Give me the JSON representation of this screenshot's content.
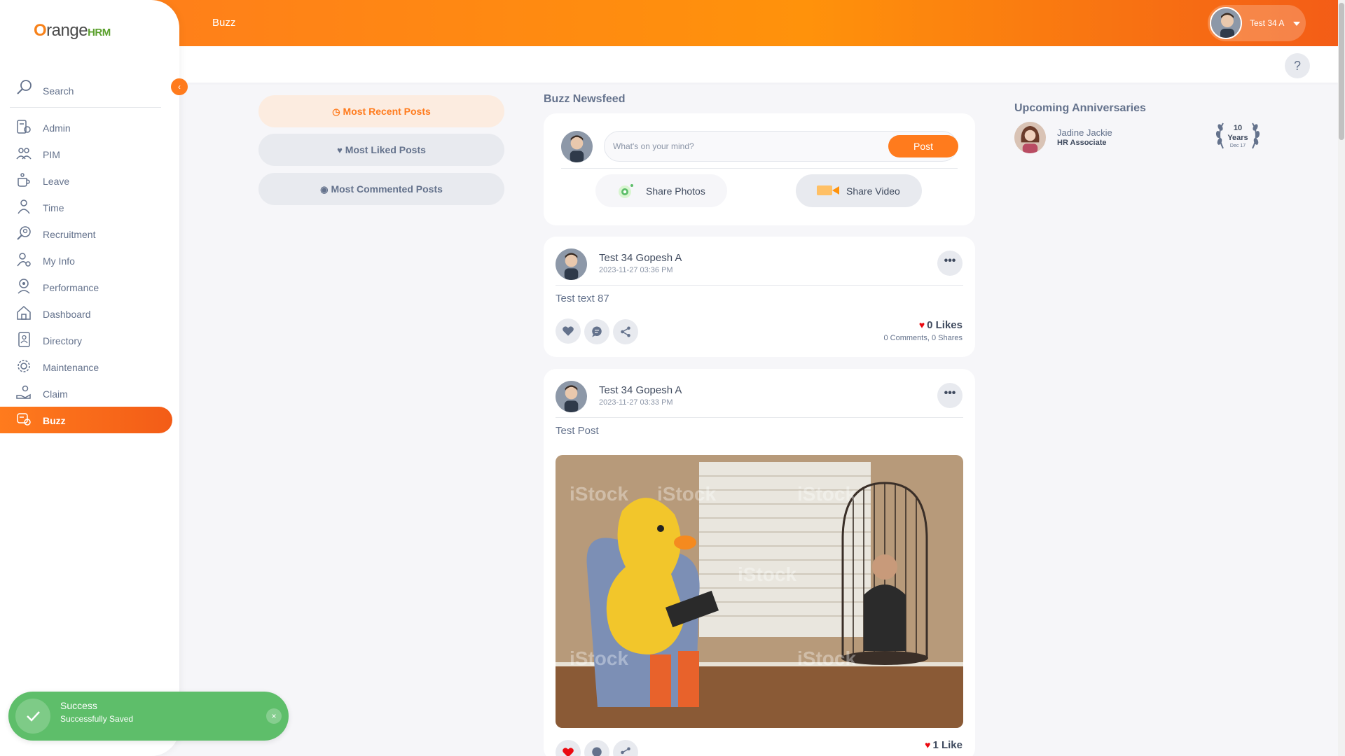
{
  "app": {
    "module_title": "Buzz",
    "help_label": "?",
    "brand": {
      "o": "O",
      "range": "range",
      "hrm": "HRM"
    }
  },
  "user": {
    "name": "Test 34 A"
  },
  "sidebar": {
    "search_label": "Search",
    "collapse_label": "‹",
    "items": [
      {
        "label": "Admin",
        "icon": "admin-icon"
      },
      {
        "label": "PIM",
        "icon": "pim-icon"
      },
      {
        "label": "Leave",
        "icon": "leave-icon"
      },
      {
        "label": "Time",
        "icon": "time-icon"
      },
      {
        "label": "Recruitment",
        "icon": "recruitment-icon"
      },
      {
        "label": "My Info",
        "icon": "my-info-icon"
      },
      {
        "label": "Performance",
        "icon": "performance-icon"
      },
      {
        "label": "Dashboard",
        "icon": "dashboard-icon"
      },
      {
        "label": "Directory",
        "icon": "directory-icon"
      },
      {
        "label": "Maintenance",
        "icon": "maintenance-icon"
      },
      {
        "label": "Claim",
        "icon": "claim-icon"
      },
      {
        "label": "Buzz",
        "icon": "buzz-icon",
        "active": true
      }
    ]
  },
  "filters": {
    "most_recent": "Most Recent Posts",
    "most_liked": "Most Liked Posts",
    "most_commented": "Most Commented Posts"
  },
  "feed": {
    "title": "Buzz Newsfeed",
    "composer": {
      "placeholder": "What's on your mind?",
      "post_label": "Post",
      "share_photos": "Share Photos",
      "share_video": "Share Video"
    },
    "posts": [
      {
        "author": "Test 34 Gopesh A",
        "timestamp": "2023-11-27 03:36 PM",
        "text": "Test text 87",
        "likes": "0 Likes",
        "comments": "0 Comments",
        "shares": "0 Shares",
        "more": "•••"
      },
      {
        "author": "Test 34 Gopesh A",
        "timestamp": "2023-11-27 03:33 PM",
        "text": "Test Post",
        "likes": "1 Like",
        "more": "•••",
        "image_watermark": "iStock"
      }
    ]
  },
  "anniversaries": {
    "title": "Upcoming Anniversaries",
    "items": [
      {
        "name": "Jadine Jackie",
        "role": "HR Associate",
        "years": "10",
        "years_label": "Years",
        "date": "Dec 17"
      }
    ]
  },
  "toast": {
    "title": "Success",
    "message": "Successfully Saved",
    "close": "×"
  },
  "colors": {
    "brand_orange": "#ff7b1d",
    "success_green": "#5ebe6a",
    "like_red": "#eb0910"
  }
}
